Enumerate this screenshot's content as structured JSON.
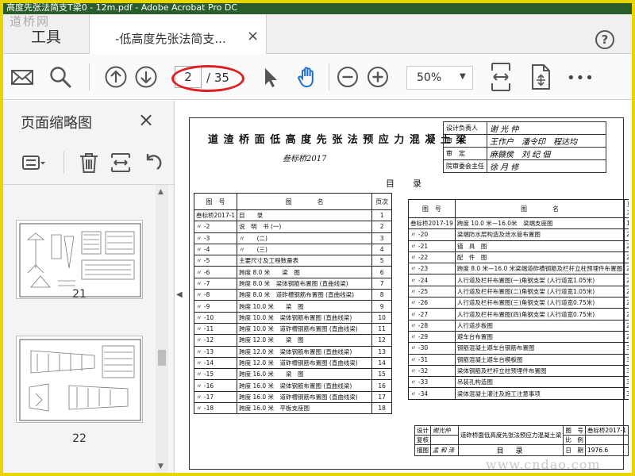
{
  "window": {
    "title": "高度先张法简支T梁0 - 12m.pdf - Adobe Acrobat Pro DC",
    "watermark": "道桥网"
  },
  "tabs": {
    "tools": "工具",
    "document": "-低高度先张法简支...",
    "close_symbol": "×",
    "help_symbol": "?"
  },
  "toolbar": {
    "page_current": "2",
    "page_total": "/ 35",
    "zoom": "50%",
    "zoom_caret": "▼",
    "more": "•••",
    "icons": [
      "mail-icon",
      "search-icon",
      "prev-page-icon",
      "next-page-icon",
      "select-cursor-icon",
      "hand-icon",
      "zoom-out-icon",
      "zoom-in-icon",
      "fit-width-icon",
      "rotate-page-icon",
      "more-icon"
    ],
    "highlight_color": "#e02020"
  },
  "sidebar": {
    "title": "页面缩略图",
    "close_symbol": "×",
    "thumbnails": [
      {
        "number": "21"
      },
      {
        "number": "22"
      }
    ]
  },
  "document": {
    "title": "道 渣 桥 面 低 高 度 先 张 法 预 应 力 混 凝 土 梁",
    "subtitle": "叁标桥2017",
    "sign_block": {
      "rows": [
        {
          "label": "设计负责人",
          "name": "谢 光 仲"
        },
        {
          "label": "审　查",
          "name": "王作户　潘令印　程达均"
        },
        {
          "label": "审　定",
          "name": "麻赣侯　刘 纪 佃"
        },
        {
          "label": "院审委会主任",
          "name": "徐 月 修"
        }
      ]
    },
    "catalog_title": "目　录",
    "columns": [
      "图　号",
      "图　　　　名",
      "页次"
    ],
    "left_rows": [
      [
        "叁标桥2017-1",
        "目　　录",
        "1"
      ],
      [
        "〃 -2",
        "说　明　书 (一)",
        "2"
      ],
      [
        "〃 -3",
        "〃　　(二)",
        "3"
      ],
      [
        "〃 -4",
        "〃　　(三)",
        "4"
      ],
      [
        "〃 -5",
        "主要尺寸及工程数量表",
        "5"
      ],
      [
        "〃 -6",
        "跨度 8.0 米　　梁　图",
        "6"
      ],
      [
        "〃 -7",
        "跨度 8.0 米　梁体钢筋布置图 (直曲线梁)",
        "7"
      ],
      [
        "〃 -8",
        "跨度 8.0 米　道砟槽钢筋布置图 (直曲线梁)",
        "8"
      ],
      [
        "〃 -9",
        "跨度 10.0 米　　梁　图",
        "9"
      ],
      [
        "〃 -10",
        "跨度 10.0 米　梁体钢筋布置图 (直曲线梁)",
        "10"
      ],
      [
        "〃 -11",
        "跨度 10.0 米　道砟槽钢筋布置图 (直曲线梁)",
        "11"
      ],
      [
        "〃 -12",
        "跨度 12.0 米　　梁　图",
        "12"
      ],
      [
        "〃 -13",
        "跨度 12.0 米　梁体钢筋布置图 (直曲线梁)",
        "13"
      ],
      [
        "〃 -14",
        "跨度 12.0 米　道砟槽钢筋布置图 (直曲线梁)",
        "14"
      ],
      [
        "〃 -15",
        "跨度 16.0 米　　梁　图",
        "15"
      ],
      [
        "〃 -16",
        "跨度 16.0 米　梁体钢筋布置图 (直曲线梁)",
        "16"
      ],
      [
        "〃 -17",
        "跨度 16.0 米　道砟槽钢筋布置图 (直曲线梁)",
        "17"
      ],
      [
        "〃 -18",
        "跨度 16.0 米　平板支座图",
        "18"
      ]
    ],
    "right_rows": [
      [
        "叁标桥2017-19",
        "跨度 10.0 米—16.0米　梁端支座图",
        "19"
      ],
      [
        "〃 -20",
        "梁端防水层构造及泄水管布置图",
        "20"
      ],
      [
        "〃 -21",
        "锚　具　图",
        "21"
      ],
      [
        "〃 -22",
        "配　件　图",
        "22"
      ],
      [
        "〃 -23",
        "跨度 8.0 米—16.0 米梁端道砟槽钢筋及栏杆立柱预埋件布置图",
        "23"
      ],
      [
        "〃 -24",
        "人行道及栏杆布置图(一)角钢支架 (人行道宽1.05米)",
        "24"
      ],
      [
        "〃 -25",
        "人行道及栏杆布置图(二)角钢支架 (人行道宽1.05米)",
        "25"
      ],
      [
        "〃 -26",
        "人行道及栏杆布置图(三)角钢支架 (人行道宽0.75米)",
        "26"
      ],
      [
        "〃 -27",
        "人行道及栏杆布置图(四)角钢支架 (人行道宽0.75米)",
        "27"
      ],
      [
        "〃 -28",
        "人行道步板图",
        "28"
      ],
      [
        "〃 -29",
        "避车台布置图",
        "29"
      ],
      [
        "〃 -30",
        "钢筋混凝土避车台钢筋布置图",
        "30"
      ],
      [
        "〃 -31",
        "钢筋混凝土避车台模板图",
        "31"
      ],
      [
        "〃 -32",
        "梁体钢筋及栏杆立柱预埋件布置图",
        "32"
      ],
      [
        "〃 -33",
        "吊装孔构造图",
        "33"
      ],
      [
        "〃 -34",
        "梁体混凝土灌注及施工注意事项",
        "34"
      ]
    ],
    "footer": {
      "design_label": "设计",
      "design_name": "谢光仲",
      "check_label": "复核",
      "check_name": "",
      "draw_label": "描图",
      "draw_name": "孟 和 泽",
      "title": "道砟桥面低高度先张法预应力混凝土梁",
      "subtitle": "目　录",
      "fig_label": "图　号",
      "fig_value": "叁标桥2017-1",
      "scale_label": "比　例",
      "scale_value": "",
      "date_label": "日　期",
      "date_value": "1976.6"
    }
  },
  "site_watermark": "www.cndao.com"
}
